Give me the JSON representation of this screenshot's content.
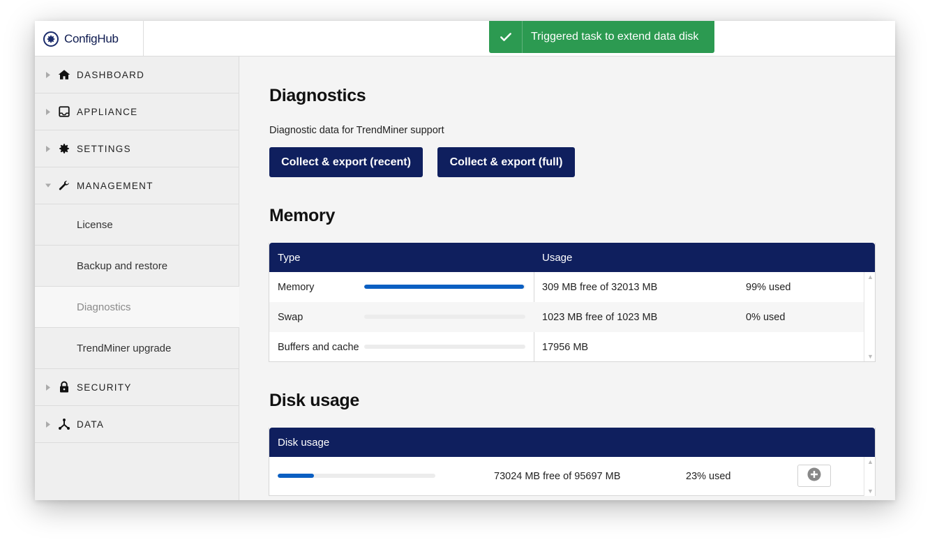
{
  "app": {
    "name": "ConfigHub",
    "logo_icon": "gear-icon"
  },
  "toast": {
    "message": "Triggered task to extend data disk",
    "icon": "check-icon",
    "color": "#2c9a51"
  },
  "sidebar": {
    "items": [
      {
        "label": "DASHBOARD",
        "icon": "home-icon"
      },
      {
        "label": "APPLIANCE",
        "icon": "monitor-icon"
      },
      {
        "label": "SETTINGS",
        "icon": "gear-icon"
      },
      {
        "label": "MANAGEMENT",
        "icon": "wrench-icon",
        "expanded": true
      },
      {
        "label": "SECURITY",
        "icon": "lock-icon"
      },
      {
        "label": "DATA",
        "icon": "network-icon"
      }
    ],
    "management_subitems": [
      {
        "label": "License"
      },
      {
        "label": "Backup and restore"
      },
      {
        "label": "Diagnostics",
        "active": true
      },
      {
        "label": "TrendMiner upgrade"
      }
    ]
  },
  "diagnostics": {
    "title": "Diagnostics",
    "subtitle": "Diagnostic data for TrendMiner support",
    "buttons": {
      "recent": "Collect & export (recent)",
      "full": "Collect & export (full)"
    }
  },
  "memory": {
    "title": "Memory",
    "columns": {
      "type": "Type",
      "usage": "Usage"
    },
    "rows": [
      {
        "type": "Memory",
        "usage": "309 MB free of 32013 MB",
        "percent": "99% used",
        "fill": 0.99
      },
      {
        "type": "Swap",
        "usage": "1023 MB free of 1023 MB",
        "percent": "0% used",
        "fill": 0.0
      },
      {
        "type": "Buffers and cache",
        "usage": "17956 MB",
        "percent": "",
        "fill": 0.0
      }
    ]
  },
  "disk": {
    "title": "Disk usage",
    "column": "Disk usage",
    "rows": [
      {
        "usage": "73024 MB free of 95697 MB",
        "percent": "23% used",
        "fill": 0.23
      }
    ]
  },
  "colors": {
    "navy": "#0f1f5e",
    "bar_blue": "#0b5fc2",
    "success_green": "#2c9a51"
  }
}
